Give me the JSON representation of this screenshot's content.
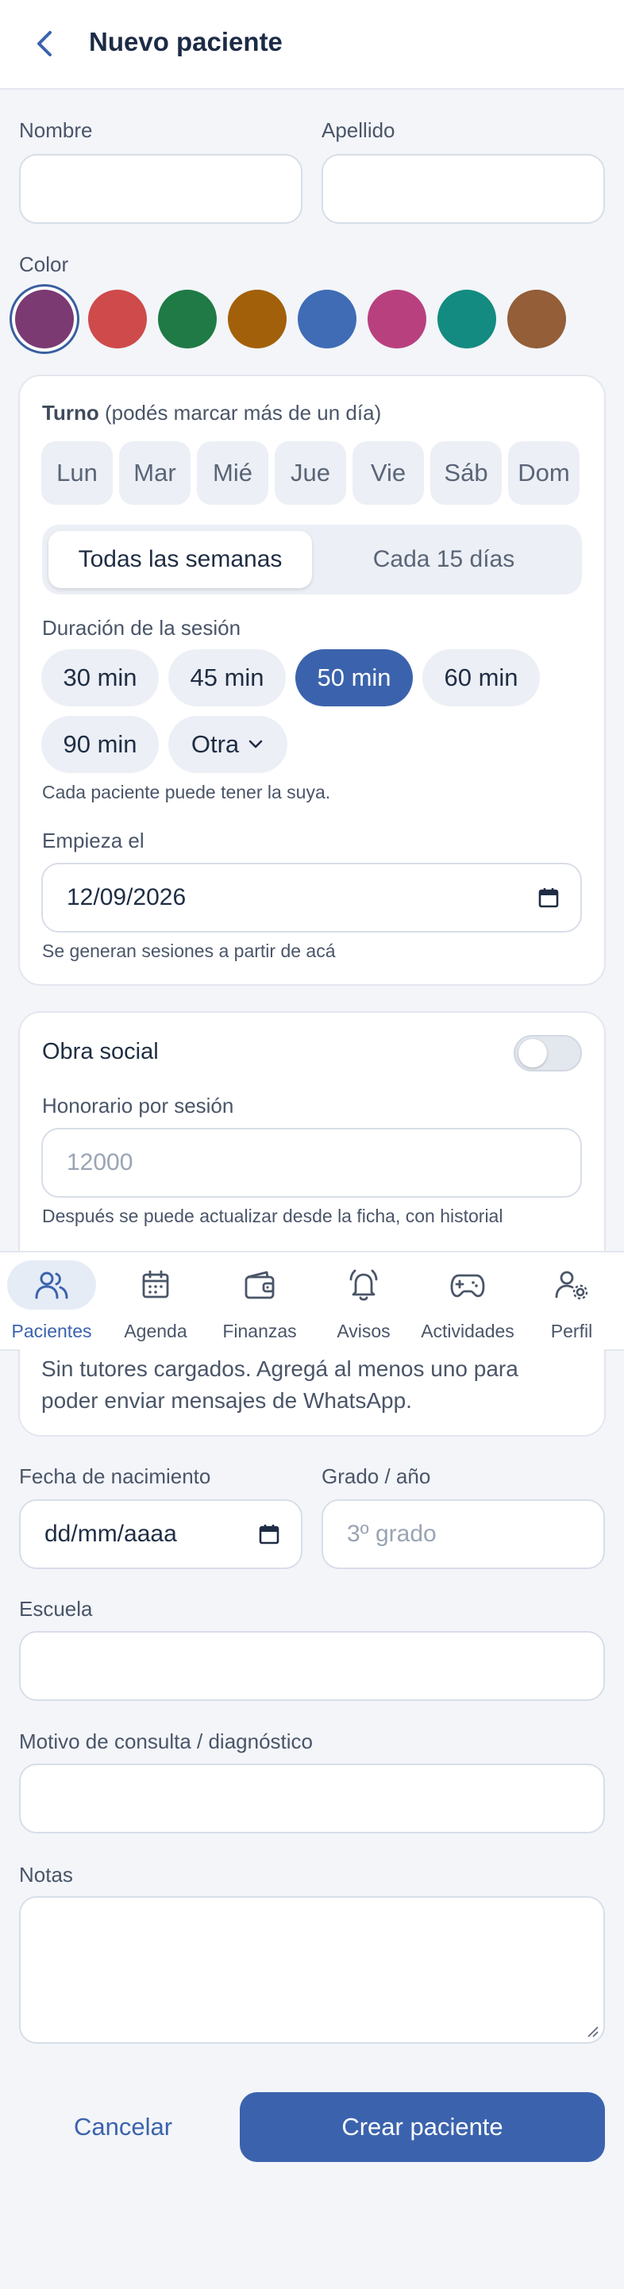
{
  "header": {
    "title": "Nuevo paciente"
  },
  "form": {
    "nombre_label": "Nombre",
    "apellido_label": "Apellido",
    "color_label": "Color",
    "colors": [
      "#7b3a72",
      "#cf4a4a",
      "#1f7a45",
      "#a3600a",
      "#3f6cb5",
      "#b9407f",
      "#138b80",
      "#935e38"
    ],
    "nacimiento_label": "Fecha de nacimiento",
    "nacimiento_value": "dd/mm/aaaa",
    "grado_label": "Grado / año",
    "grado_placeholder": "3º grado",
    "escuela_label": "Escuela",
    "motivo_label": "Motivo de consulta / diagnóstico",
    "notas_label": "Notas"
  },
  "turno": {
    "title": "Turno",
    "subtitle": "(podés marcar más de un día)",
    "days": [
      "Lun",
      "Mar",
      "Mié",
      "Jue",
      "Vie",
      "Sáb",
      "Dom"
    ],
    "frequency": [
      "Todas las semanas",
      "Cada 15 días"
    ],
    "duration_label": "Duración de la sesión",
    "durations": [
      "30 min",
      "45 min",
      "50 min",
      "60 min",
      "90 min"
    ],
    "other_label": "Otra",
    "duration_hint": "Cada paciente puede tener la suya.",
    "start_label": "Empieza el",
    "start_value": "12/09/2026",
    "start_hint": "Se generan sesiones a partir de acá"
  },
  "billing": {
    "obra_social_label": "Obra social",
    "honorario_label": "Honorario por sesión",
    "honorario_placeholder": "12000",
    "honorario_hint": "Después se puede actualizar desde la ficha, con historial"
  },
  "tutores": {
    "empty_line1": "Sin tutores cargados. Agregá al menos uno para",
    "empty_line2": "poder enviar mensajes de WhatsApp."
  },
  "nav": {
    "items": [
      "Pacientes",
      "Agenda",
      "Finanzas",
      "Avisos",
      "Actividades",
      "Perfil"
    ]
  },
  "actions": {
    "cancel": "Cancelar",
    "create": "Crear paciente"
  }
}
